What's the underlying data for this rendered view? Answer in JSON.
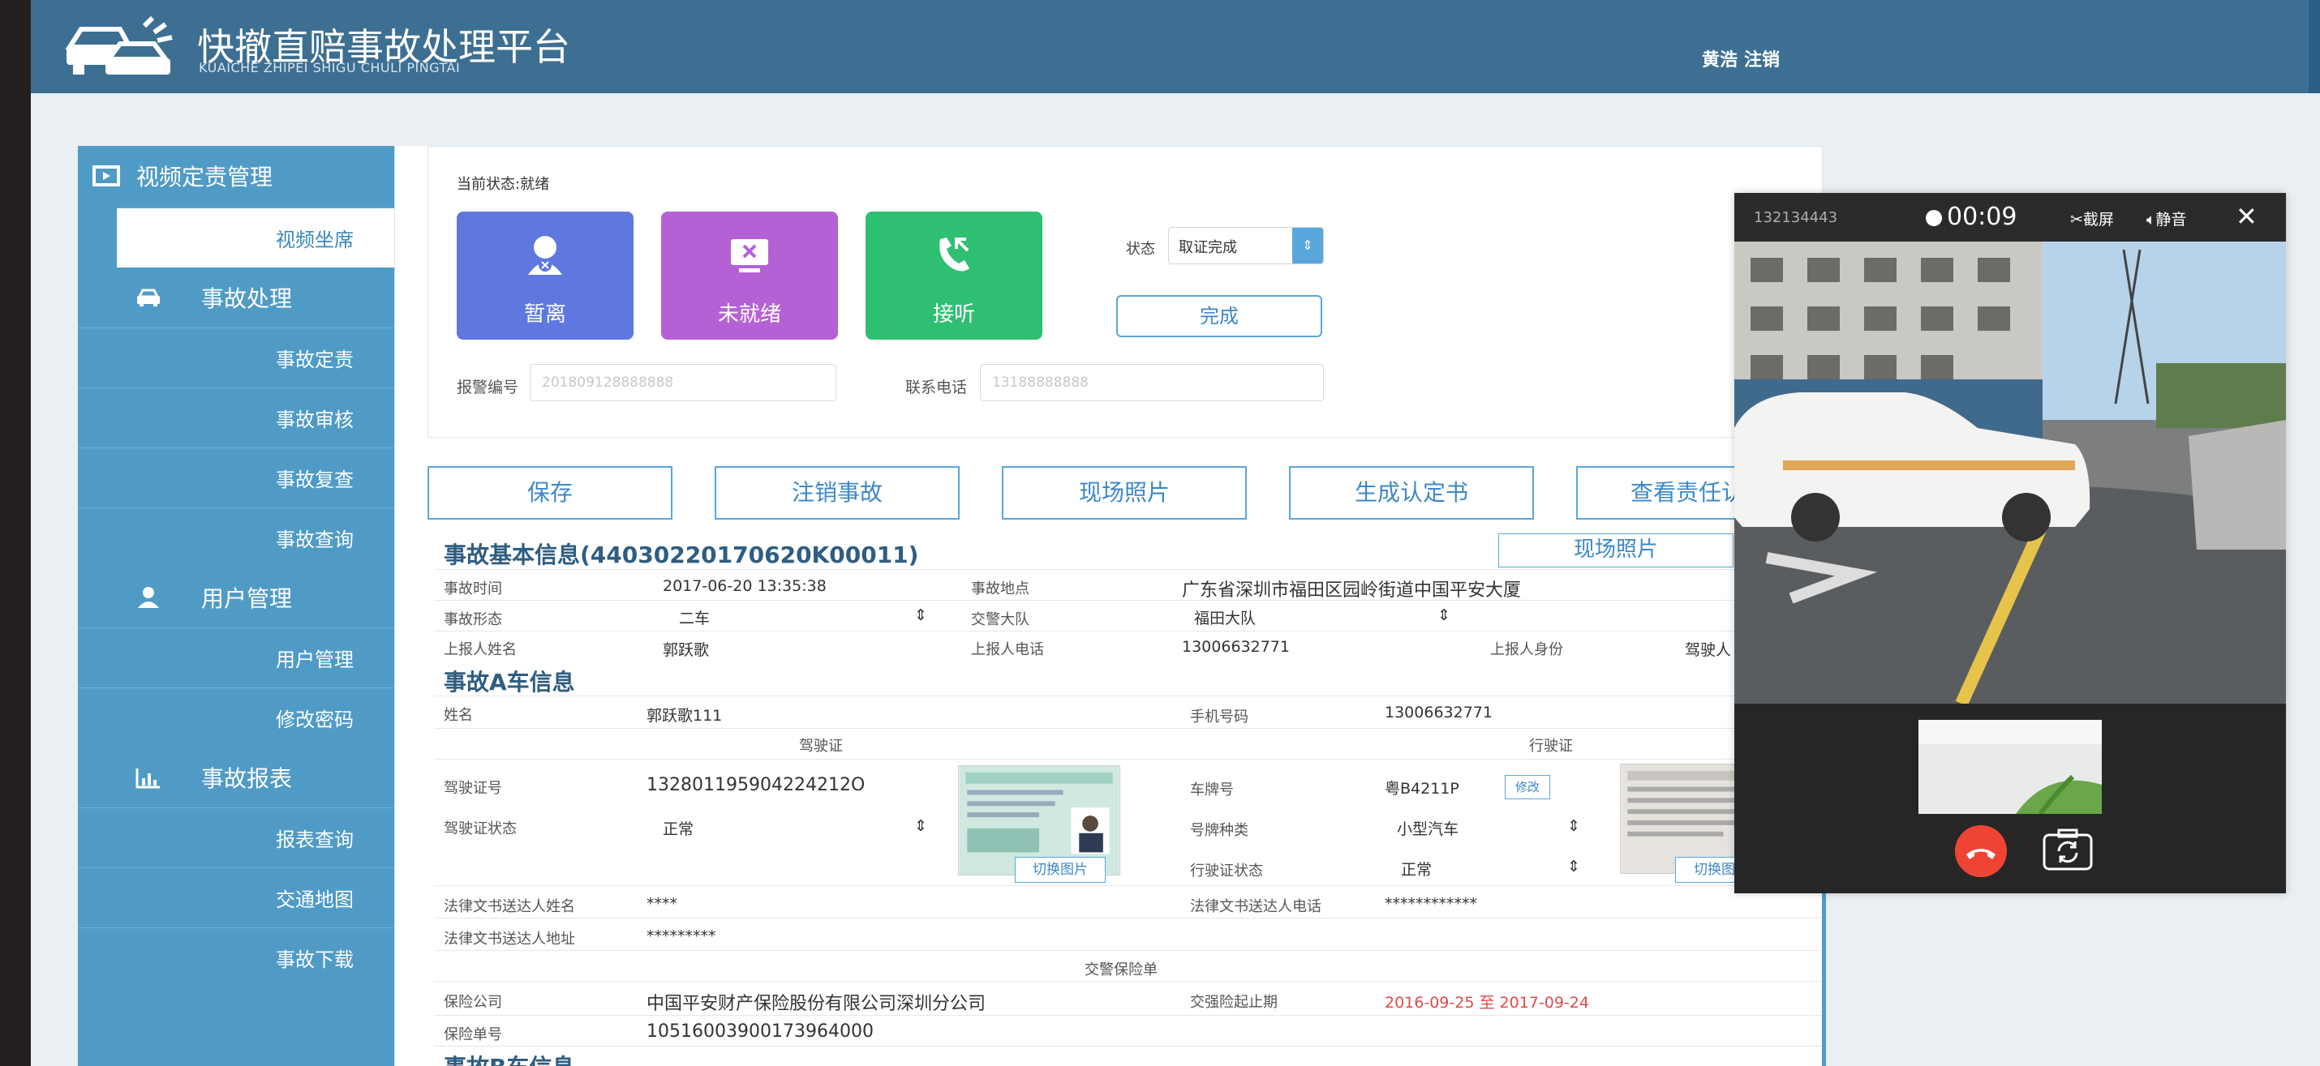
{
  "header": {
    "title": "快撤直赔事故处理平台",
    "subtitle": "KUAICHE ZHIPEI SHIGU CHULI PINGTAI",
    "user_name": "黄浩",
    "logout": "注销"
  },
  "sidebar": {
    "groups": [
      {
        "label": "视频定责管理",
        "icon": "monitor-icon",
        "items": [
          "视频坐席"
        ]
      },
      {
        "label": "事故处理",
        "icon": "car-icon",
        "items": [
          "事故定责",
          "事故审核",
          "事故复查",
          "事故查询"
        ]
      },
      {
        "label": "用户管理",
        "icon": "user-icon",
        "items": [
          "用户管理",
          "修改密码"
        ]
      },
      {
        "label": "事故报表",
        "icon": "bar-chart-icon",
        "items": [
          "报表查询",
          "交通地图",
          "事故下载"
        ]
      }
    ],
    "active_item": "视频坐席"
  },
  "status_panel": {
    "current_status": "当前状态:就绪",
    "buttons": {
      "away": "暂离",
      "not_ready": "未就绪",
      "answer": "接听"
    },
    "state_label": "状态",
    "state_value": "取证完成",
    "complete": "完成",
    "report_no_label": "报警编号",
    "report_no_placeholder": "201809128888888",
    "phone_label": "联系电话",
    "phone_placeholder": "13188888888"
  },
  "actions": [
    "保存",
    "注销事故",
    "现场照片",
    "生成认定书",
    "查看责任认定"
  ],
  "basic_info": {
    "title": "事故基本信息(44030220170620K00011)",
    "photo_button": "现场照片",
    "time_label": "事故时间",
    "time": "2017-06-20 13:35:38",
    "place_label": "事故地点",
    "place": "广东省深圳市福田区园岭街道中国平安大厦",
    "form_label": "事故形态",
    "form": "二车",
    "police_label": "交警大队",
    "police": "福田大队",
    "reporter_label": "上报人姓名",
    "reporter": "郭跃歌",
    "reporter_phone_label": "上报人电话",
    "reporter_phone": "13006632771",
    "reporter_id_label": "上报人身份",
    "reporter_id": "驾驶人"
  },
  "car_a": {
    "title": "事故A车信息",
    "name_label": "姓名",
    "name": "郭跃歌111",
    "mobile_label": "手机号码",
    "mobile": "13006632771",
    "license_header": "驾驶证",
    "vehicle_license_header": "行驶证",
    "license_no_label": "驾驶证号",
    "license_no": "132801195904224212O",
    "plate_label": "车牌号",
    "plate": "粤B4211P",
    "edit": "修改",
    "license_status_label": "驾驶证状态",
    "license_status": "正常",
    "plate_type_label": "号牌种类",
    "plate_type": "小型汽车",
    "vehicle_status_label": "行驶证状态",
    "vehicle_status": "正常",
    "switch_image": "切换图片",
    "legal_name_label": "法律文书送达人姓名",
    "legal_name": "****",
    "legal_phone_label": "法律文书送达人电话",
    "legal_phone": "************",
    "legal_addr_label": "法律文书送达人地址",
    "legal_addr": "*********",
    "insurance_header": "交警保险单",
    "insurer_label": "保险公司",
    "insurer": "中国平安财产保险股份有限公司深圳分公司",
    "period_label": "交强险起止期",
    "period_start": "2016-09-25",
    "period_to": "至",
    "period_end": "2017-09-24",
    "policy_label": "保险单号",
    "policy": "10516003900173964000"
  },
  "car_b": {
    "title": "事故B车信息"
  },
  "video": {
    "caller_id": "132134443",
    "timer": "00:09",
    "screenshot": "截屏",
    "mute": "静音"
  }
}
